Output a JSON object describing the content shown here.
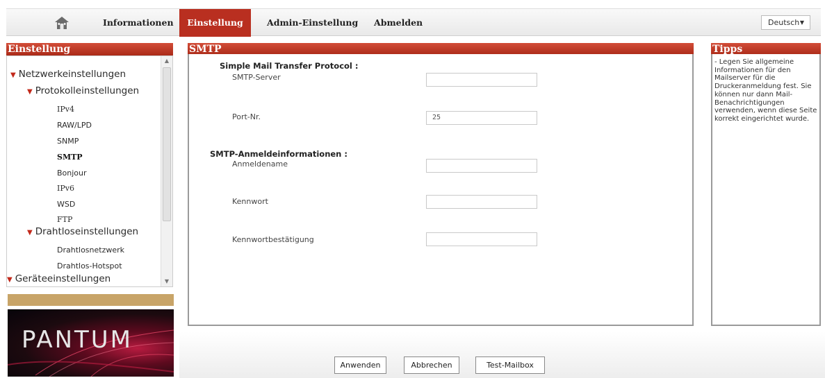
{
  "nav": {
    "items": [
      {
        "label": "Informationen"
      },
      {
        "label": "Einstellung"
      },
      {
        "label": "Admin-Einstellung"
      },
      {
        "label": "Abmelden"
      }
    ],
    "language": "Deutsch"
  },
  "sidebar": {
    "title": "Einstellung",
    "tree": [
      {
        "label": "Netzwerkeinstellungen"
      },
      {
        "label": "Protokolleinstellungen"
      },
      {
        "label": "IPv4"
      },
      {
        "label": "RAW/LPD"
      },
      {
        "label": "SNMP"
      },
      {
        "label": "SMTP"
      },
      {
        "label": "Bonjour"
      },
      {
        "label": "IPv6"
      },
      {
        "label": "WSD"
      },
      {
        "label": "FTP"
      },
      {
        "label": "Drahtloseinstellungen"
      },
      {
        "label": "Drahtlosnetzwerk"
      },
      {
        "label": "Drahtlos-Hotspot"
      },
      {
        "label": "Geräteeinstellungen"
      }
    ],
    "selected": "SMTP",
    "logo_text": "PANTUM"
  },
  "main": {
    "title": "SMTP",
    "section1_heading": "Simple Mail Transfer Protocol :",
    "smtp_server_label": "SMTP-Server",
    "smtp_server_value": "",
    "port_label": "Port-Nr.",
    "port_value": "25",
    "section2_heading": "SMTP-Anmeldeinformationen :",
    "login_label": "Anmeldename",
    "login_value": "",
    "password_label": "Kennwort",
    "password_value": "",
    "password_confirm_label": "Kennwortbestätigung",
    "password_confirm_value": ""
  },
  "tips": {
    "title": "Tipps",
    "text": "- Legen Sie allgemeine Informationen für den Mailserver für die Druckeranmeldung fest. Sie können nur dann Mail-Benachrichtigungen verwenden, wenn diese Seite korrekt eingerichtet wurde."
  },
  "buttons": {
    "apply": "Anwenden",
    "cancel": "Abbrechen",
    "test": "Test-Mailbox"
  },
  "colors": {
    "accent": "#b92f20",
    "header_gradient_top": "#d24d38",
    "tan_bar": "#c8a468"
  }
}
